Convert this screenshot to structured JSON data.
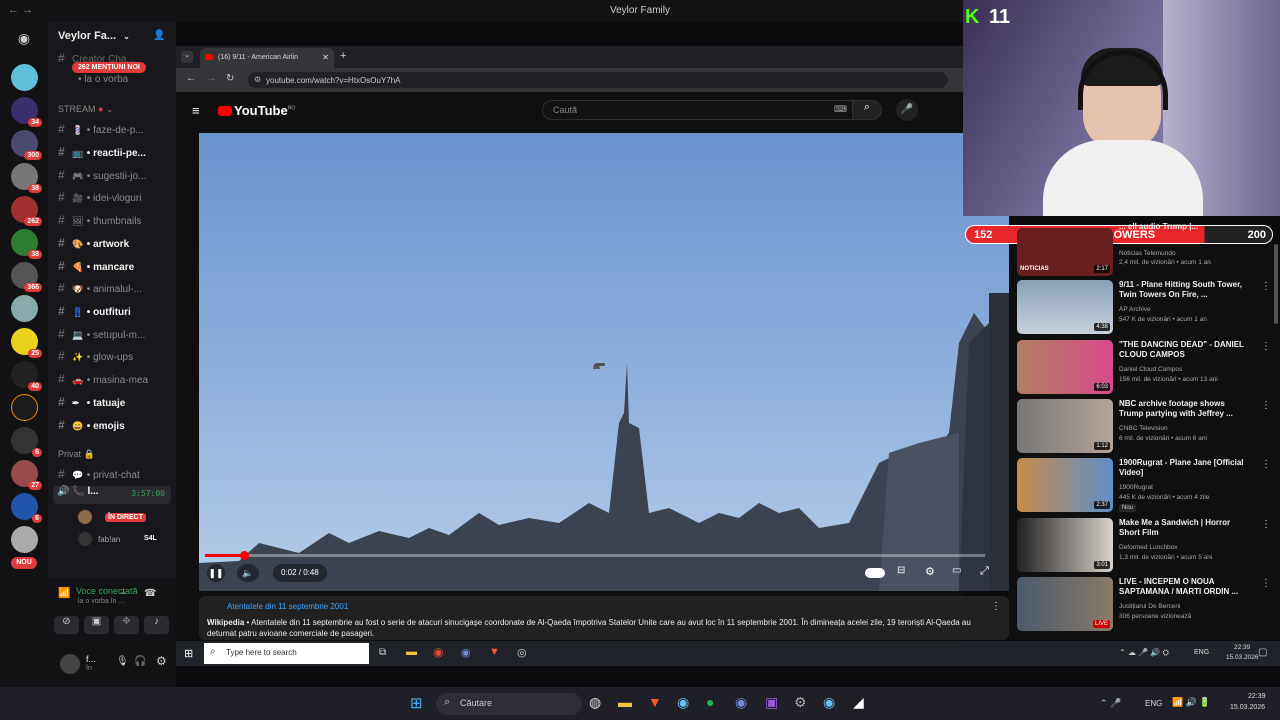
{
  "window": {
    "title": "Veylor Family"
  },
  "counter": {
    "value": "11"
  },
  "discord": {
    "server_name": "Veylor Fa...",
    "mentions_badge": "262 MENȚIUNI NOI",
    "top_channel": "Creator Cha...",
    "top_voice": "la o vorba",
    "category_stream": "STREAM",
    "channels": [
      {
        "name": "faze-de-p...",
        "bold": false,
        "emoji": "💈"
      },
      {
        "name": "reactii-pe...",
        "bold": true,
        "emoji": "📺"
      },
      {
        "name": "sugestii-jo...",
        "bold": false,
        "emoji": "🎮"
      },
      {
        "name": "idei-vloguri",
        "bold": false,
        "emoji": "🎥"
      },
      {
        "name": "thumbnails",
        "bold": false,
        "emoji": "🖼"
      },
      {
        "name": "artwork",
        "bold": true,
        "emoji": "🎨"
      },
      {
        "name": "mancare",
        "bold": true,
        "emoji": "🍕"
      },
      {
        "name": "animalul-...",
        "bold": false,
        "emoji": "🐶"
      },
      {
        "name": "outfituri",
        "bold": true,
        "emoji": "👖"
      },
      {
        "name": "setupul-m...",
        "bold": false,
        "emoji": "💻"
      },
      {
        "name": "glow-ups",
        "bold": false,
        "emoji": "✨"
      },
      {
        "name": "masina-mea",
        "bold": false,
        "emoji": "🚗"
      },
      {
        "name": "tatuaje",
        "bold": true,
        "emoji": "✒"
      },
      {
        "name": "emojis",
        "bold": true,
        "emoji": "😀"
      }
    ],
    "category_private": "Privat",
    "private_chat": "privat-chat",
    "voice_channel": "l...",
    "voice_time": "3:57:00",
    "live_badge": "ÎN DIRECT",
    "voice_user": "fab!an",
    "voice_user_tag": "S4L",
    "server_badges": [
      "34",
      "300",
      "38",
      "262",
      "38",
      "366",
      "25",
      "40",
      "6",
      "27",
      "6",
      "NOU"
    ],
    "voice_status": "Voce conectată",
    "voice_status_sub": "la o vorba în ...",
    "user_name": "f...",
    "user_status": "în"
  },
  "browser": {
    "tab_title": "(16) 9/11 - American Airlin",
    "url": "youtube.com/watch?v=HtxOsOuY7hA"
  },
  "youtube": {
    "logo": "YouTube",
    "logo_region": "RO",
    "search_placeholder": "Caută",
    "time_display": "0:02 / 0:48",
    "progress": 0.05,
    "info_title": "Atentatele din 11 septembrie 2001",
    "info_source": "Wikipedia",
    "info_text": "• Atentatele din 11 septembrie au fost o serie de atacuri sinucigașe coordonate de Al-Qaeda împotriva Statelor Unite care au avut loc în 11 septembrie 2001. În dimineața acelei zile, 19 teroriști Al-Qaeda au deturnat patru avioane comerciale de pasageri."
  },
  "followers": {
    "current": "152",
    "label": "FOLLOWERS",
    "goal": "200"
  },
  "related": [
    {
      "title": "... ell audio Trump |...",
      "channel": "Noticias Telemundo",
      "meta": "2,4 mil. de vizionări • acum 1 an",
      "duration": "2:17",
      "overlay": "NOTICIAS"
    },
    {
      "title": "9/11 - Plane Hitting South Tower, Twin Towers On Fire, ...",
      "channel": "AP Archive",
      "meta": "547 K de vizionări • acum 1 an",
      "duration": "4:38"
    },
    {
      "title": "\"THE DANCING DEAD\" - DANIEL CLOUD CAMPOS",
      "channel": "Daniel Cloud Campos",
      "meta": "156 mil. de vizionări • acum 13 ani",
      "duration": "6:03"
    },
    {
      "title": "NBC archive footage shows Trump partying with Jeffrey ...",
      "channel": "CNBC Television",
      "meta": "6 mil. de vizionări • acum 6 ani",
      "duration": "1:12"
    },
    {
      "title": "1900Rugrat - Plane Jane [Official Video]",
      "channel": "1900Rugrat",
      "meta": "445 K de vizionări • acum 4 zile",
      "duration": "2:37",
      "badge": "Nou"
    },
    {
      "title": "Make Me a Sandwich | Horror Short Film",
      "channel": "Deformed Lunchbox",
      "meta": "1,3 mil. de vizionări • acum 5 ani",
      "duration": "3:01"
    },
    {
      "title": "LIVE - INCEPEM O NOUA SAPTAMANA / MARTI ORDIN ...",
      "channel": "Justițiarul De Berceni",
      "meta": "306 persoane vizionează",
      "duration": "LIVE"
    }
  ],
  "inner_taskbar": {
    "search": "Type here to search",
    "lang": "ENG",
    "time": "22:39",
    "date": "15.03.2026"
  },
  "main_taskbar": {
    "search": "Căutare",
    "lang": "ENG",
    "time": "22:39",
    "date": "15.03.2026"
  }
}
